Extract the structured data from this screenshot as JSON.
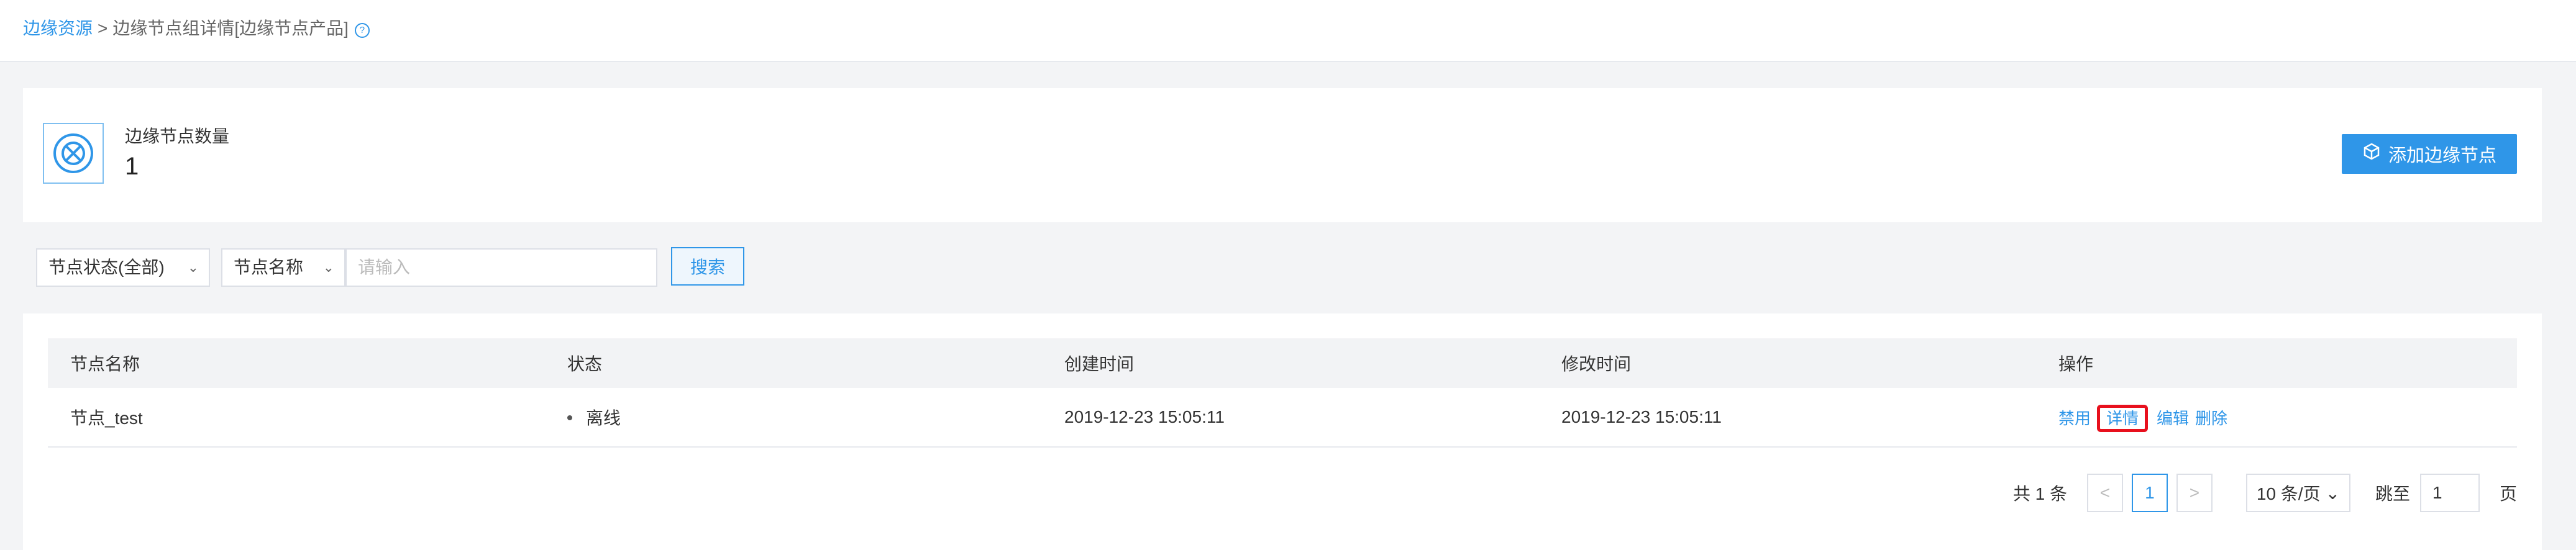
{
  "breadcrumb": {
    "root": "边缘资源",
    "separator": ">",
    "current": "边缘节点组详情[边缘节点产品]",
    "help_glyph": "?"
  },
  "summary": {
    "label": "边缘节点数量",
    "count": "1",
    "add_button": "添加边缘节点"
  },
  "filters": {
    "status_select": "节点状态(全部)",
    "field_select": "节点名称",
    "chevron": "⌄",
    "search_placeholder": "请输入",
    "search_button": "搜索"
  },
  "table": {
    "headers": [
      "节点名称",
      "状态",
      "创建时间",
      "修改时间",
      "操作"
    ],
    "rows": [
      {
        "name": "节点_test",
        "status": "离线",
        "created": "2019-12-23 15:05:11",
        "modified": "2019-12-23 15:05:11",
        "actions": [
          "禁用",
          "详情",
          "编辑",
          "删除"
        ]
      }
    ]
  },
  "pagination": {
    "total": "共 1 条",
    "prev": "<",
    "current_page": "1",
    "next": ">",
    "page_size": "10 条/页",
    "jump_label": "跳至",
    "jump_value": "1",
    "page_suffix": "页"
  },
  "colors": {
    "accent": "#2f96e8",
    "highlight": "#e8101d"
  }
}
